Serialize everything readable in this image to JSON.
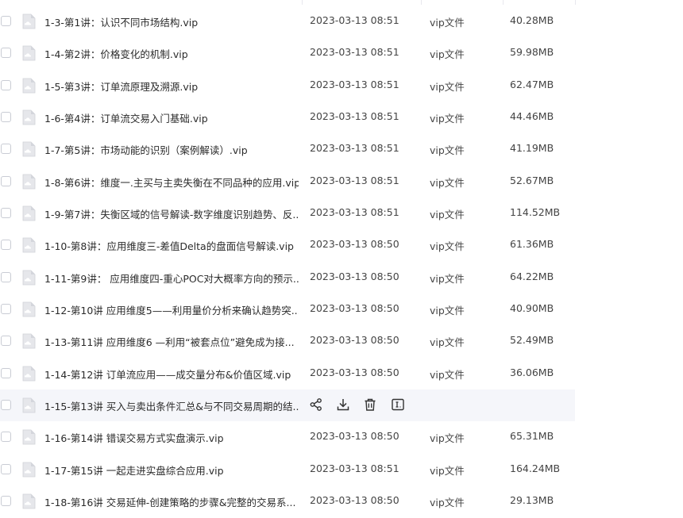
{
  "files": [
    {
      "name": "1-3-第1讲：认识不同市场结构.vip",
      "date": "2023-03-13 08:51",
      "type": "vip文件",
      "size": "40.28MB"
    },
    {
      "name": "1-4-第2讲：价格变化的机制.vip",
      "date": "2023-03-13 08:51",
      "type": "vip文件",
      "size": "59.98MB"
    },
    {
      "name": "1-5-第3讲：订单流原理及溯源.vip",
      "date": "2023-03-13 08:51",
      "type": "vip文件",
      "size": "62.47MB"
    },
    {
      "name": "1-6-第4讲：订单流交易入门基础.vip",
      "date": "2023-03-13 08:51",
      "type": "vip文件",
      "size": "44.46MB"
    },
    {
      "name": "1-7-第5讲：市场动能的识别（案例解读）.vip",
      "date": "2023-03-13 08:51",
      "type": "vip文件",
      "size": "41.19MB"
    },
    {
      "name": "1-8-第6讲：维度一.主买与主卖失衡在不同品种的应用.vip",
      "date": "2023-03-13 08:51",
      "type": "vip文件",
      "size": "52.67MB"
    },
    {
      "name": "1-9-第7讲：失衡区域的信号解读-数字维度识别趋势、反...",
      "date": "2023-03-13 08:51",
      "type": "vip文件",
      "size": "114.52MB"
    },
    {
      "name": "1-10-第8讲：应用维度三-差值Delta的盘面信号解读.vip",
      "date": "2023-03-13 08:50",
      "type": "vip文件",
      "size": "61.36MB"
    },
    {
      "name": "1-11-第9讲： 应用维度四-重心POC对大概率方向的预示....",
      "date": "2023-03-13 08:50",
      "type": "vip文件",
      "size": "64.22MB"
    },
    {
      "name": "1-12-第10讲 应用维度5——利用量价分析来确认趋势突...",
      "date": "2023-03-13 08:50",
      "type": "vip文件",
      "size": "40.90MB"
    },
    {
      "name": "1-13-第11讲 应用维度6 —利用“被套点位”避免成为接...",
      "date": "2023-03-13 08:50",
      "type": "vip文件",
      "size": "52.49MB"
    },
    {
      "name": "1-14-第12讲 订单流应用——成交量分布&价值区域.vip",
      "date": "2023-03-13 08:50",
      "type": "vip文件",
      "size": "36.06MB"
    },
    {
      "name": "1-15-第13讲 买入与卖出条件汇总&与不同交易周期的结...",
      "date": "",
      "type": "",
      "size": "",
      "hovered": true
    },
    {
      "name": "1-16-第14讲  错误交易方式实盘演示.vip",
      "date": "2023-03-13 08:50",
      "type": "vip文件",
      "size": "65.31MB"
    },
    {
      "name": "1-17-第15讲 一起走进实盘综合应用.vip",
      "date": "2023-03-13 08:51",
      "type": "vip文件",
      "size": "164.24MB"
    },
    {
      "name": "1-18-第16讲  交易延伸-创建策略的步骤&完整的交易系...",
      "date": "2023-03-13 08:50",
      "type": "vip文件",
      "size": "29.13MB"
    }
  ],
  "row_actions": [
    "share-icon",
    "download-icon",
    "delete-icon",
    "rename-icon"
  ]
}
